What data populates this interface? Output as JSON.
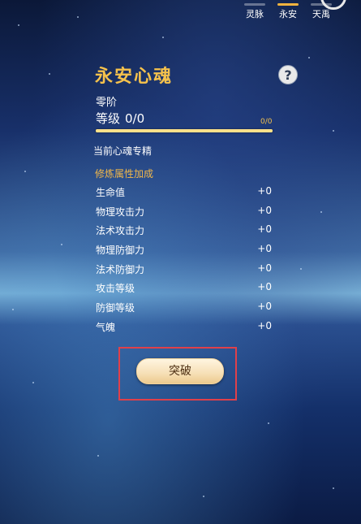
{
  "top_tabs": [
    {
      "label": "灵脉",
      "active": false
    },
    {
      "label": "永安",
      "active": true
    },
    {
      "label": "天禹",
      "active": false
    }
  ],
  "soul": {
    "title": "永安心魂",
    "help_label": "?",
    "stage": "零阶",
    "level_label": "等级",
    "level_value": "0/0",
    "exp_text": "0/0",
    "exp_progress": 1.0,
    "essence_label": "当前心魂专精",
    "section_title": "修炼属性加成"
  },
  "attributes": [
    {
      "name": "生命值",
      "value": "+0"
    },
    {
      "name": "物理攻击力",
      "value": "+0"
    },
    {
      "name": "法术攻击力",
      "value": "+0"
    },
    {
      "name": "物理防御力",
      "value": "+0"
    },
    {
      "name": "法术防御力",
      "value": "+0"
    },
    {
      "name": "攻击等级",
      "value": "+0"
    },
    {
      "name": "防御等级",
      "value": "+0"
    },
    {
      "name": "气魄",
      "value": "+0"
    }
  ],
  "actions": {
    "breakthrough_label": "突破"
  },
  "colors": {
    "title": "#f6c24c",
    "section": "#f2b84a",
    "highlight": "#e0404a"
  }
}
